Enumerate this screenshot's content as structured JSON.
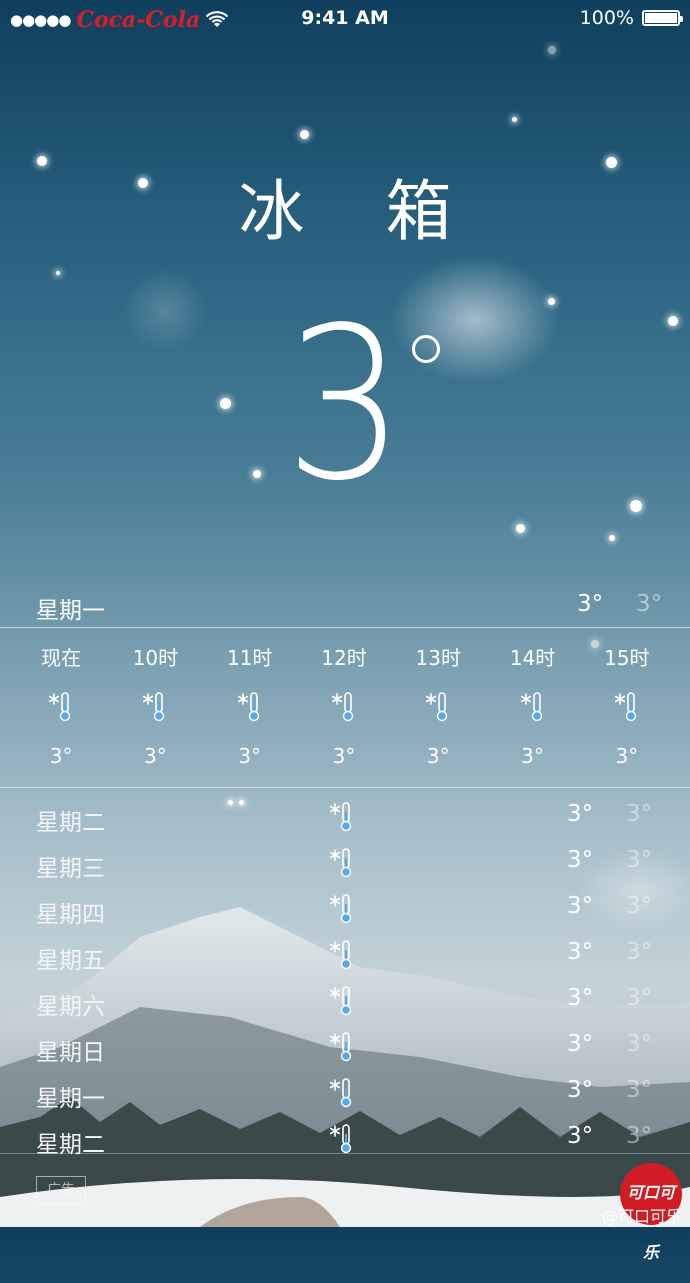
{
  "status_bar": {
    "signal": "●●●●●",
    "carrier": "Coca-Cola",
    "time": "9:41 AM",
    "battery": "100%"
  },
  "location": "冰 箱",
  "current_temp": "3",
  "today": {
    "day": "星期一",
    "high": "3°",
    "low": "3°"
  },
  "hourly": [
    {
      "label": "现在",
      "icon": "thermometer-snow-icon",
      "temp": "3°"
    },
    {
      "label": "10时",
      "icon": "thermometer-snow-icon",
      "temp": "3°"
    },
    {
      "label": "11时",
      "icon": "thermometer-snow-icon",
      "temp": "3°"
    },
    {
      "label": "12时",
      "icon": "thermometer-snow-icon",
      "temp": "3°"
    },
    {
      "label": "13时",
      "icon": "thermometer-snow-icon",
      "temp": "3°"
    },
    {
      "label": "14时",
      "icon": "thermometer-snow-icon",
      "temp": "3°"
    },
    {
      "label": "15时",
      "icon": "thermometer-snow-icon",
      "temp": "3°"
    }
  ],
  "daily": [
    {
      "day": "星期二",
      "high": "3°",
      "low": "3°"
    },
    {
      "day": "星期三",
      "high": "3°",
      "low": "3°"
    },
    {
      "day": "星期四",
      "high": "3°",
      "low": "3°"
    },
    {
      "day": "星期五",
      "high": "3°",
      "low": "3°"
    },
    {
      "day": "星期六",
      "high": "3°",
      "low": "3°"
    },
    {
      "day": "星期日",
      "high": "3°",
      "low": "3°"
    },
    {
      "day": "星期一",
      "high": "3°",
      "low": "3°"
    },
    {
      "day": "星期二",
      "high": "3°",
      "low": "3°"
    }
  ],
  "ad_label": "广告",
  "logo_text": "可口可乐",
  "watermark": "@可口可乐",
  "colors": {
    "brand_red": "#d81e28",
    "sky_top": "#0f3f5c",
    "sky_bottom": "#c4d2d8"
  }
}
